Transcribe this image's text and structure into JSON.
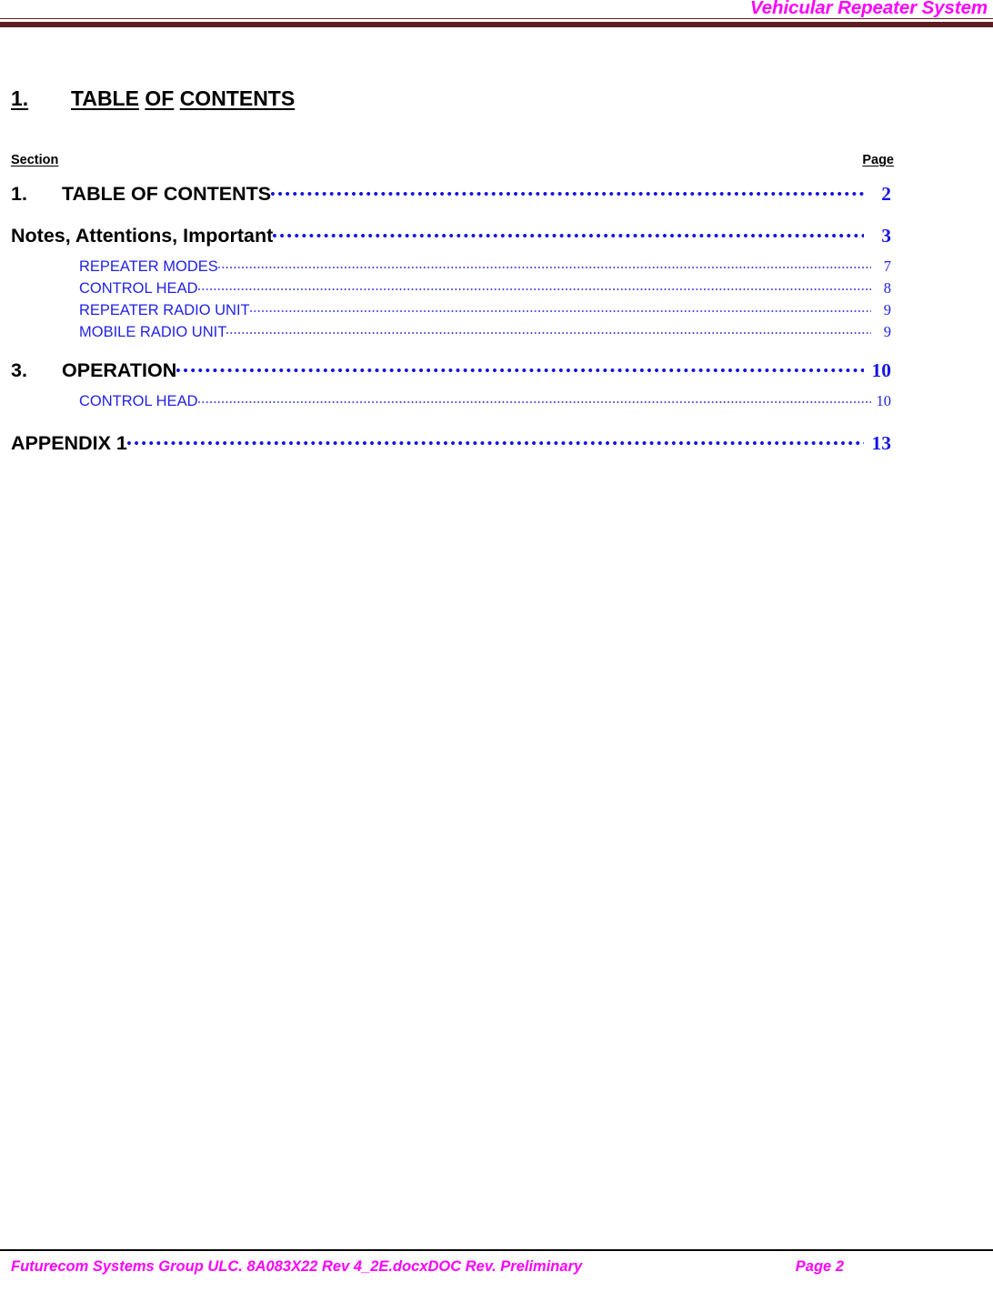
{
  "header": {
    "title": "Vehicular Repeater System",
    "title_color": "#FF00FF",
    "rule_color": "#5C2020"
  },
  "doc_title": {
    "number": "1.",
    "word1": "TABLE",
    "word2": "OF",
    "word3": "CONTENTS"
  },
  "columns": {
    "section_label": "Section",
    "page_label": "Page"
  },
  "toc": {
    "accent_color": "#1414E6",
    "sub_color": "#2222E8",
    "entries": [
      {
        "level": 1,
        "number": "1.",
        "label": "TABLE OF CONTENTS",
        "page": "2"
      },
      {
        "level": 1,
        "number": "",
        "label": "Notes, Attentions, Important",
        "page": "3"
      },
      {
        "level": 2,
        "number": "",
        "label": "REPEATER MODES",
        "page": "7"
      },
      {
        "level": 2,
        "number": "",
        "label": "CONTROL HEAD",
        "page": "8"
      },
      {
        "level": 2,
        "number": "",
        "label": "REPEATER RADIO UNIT",
        "page": "9"
      },
      {
        "level": 2,
        "number": "",
        "label": "MOBILE RADIO UNIT",
        "page": "9"
      },
      {
        "level": 1,
        "number": "3.",
        "label": "OPERATION",
        "page": "10"
      },
      {
        "level": 2,
        "number": "",
        "label": "CONTROL HEAD",
        "page": "10"
      },
      {
        "level": 1,
        "number": "",
        "label": "APPENDIX 1",
        "page": "13"
      }
    ]
  },
  "footer": {
    "left_text": "Futurecom Systems Group ULC. 8A083X22 Rev 4_2E.docxDOC Rev. Preliminary",
    "right_text": "Page 2",
    "text_color": "#FF00FF"
  }
}
